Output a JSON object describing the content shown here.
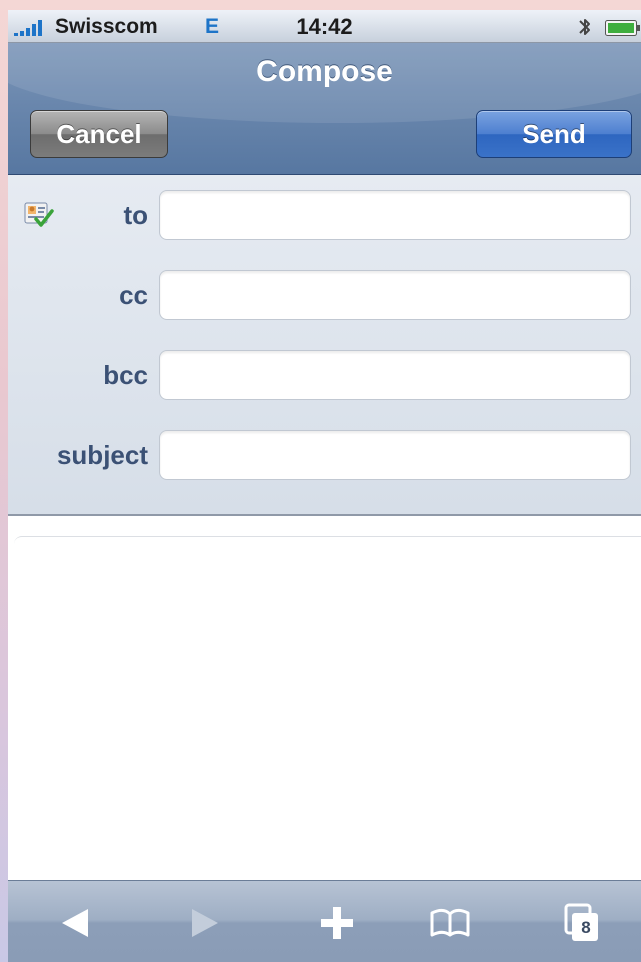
{
  "status_bar": {
    "carrier": "Swisscom",
    "network": "E",
    "time": "14:42",
    "icons": [
      "signal-icon",
      "bluetooth-icon",
      "battery-icon"
    ]
  },
  "nav_bar": {
    "title": "Compose",
    "cancel_label": "Cancel",
    "send_label": "Send"
  },
  "fields": {
    "to_label": "to",
    "to_value": "",
    "cc_label": "cc",
    "cc_value": "",
    "bcc_label": "bcc",
    "bcc_value": "",
    "subject_label": "subject",
    "subject_value": "",
    "contacts_icon": "address-book-icon"
  },
  "body": {
    "value": ""
  },
  "toolbar": {
    "items": [
      "back-icon",
      "forward-icon",
      "plus-icon",
      "bookmarks-icon",
      "pages-icon"
    ],
    "pages_count": "8",
    "forward_enabled": false
  },
  "colors": {
    "nav_bar": "#6a87ad",
    "send_button": "#3a72c8",
    "cancel_button": "#7c7c7c",
    "field_label": "#3b5175",
    "network_indicator": "#1d74c8"
  }
}
